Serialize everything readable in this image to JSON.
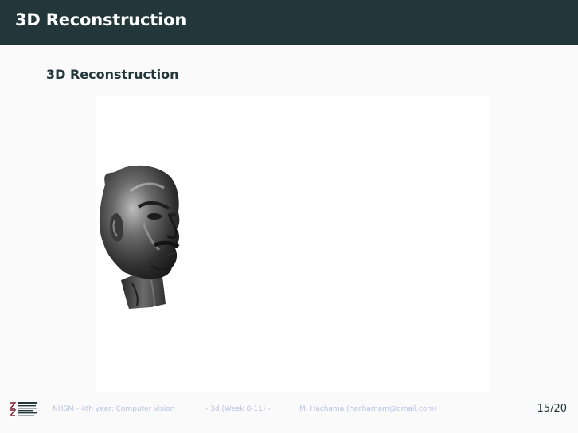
{
  "header": {
    "title": "3D Reconstruction"
  },
  "content": {
    "block_title": "3D Reconstruction",
    "figure_subject": "bronze head sculpture"
  },
  "footer": {
    "course": "NHSM - 4th year: Computer vision",
    "section": "- 3d (Week 8-11) -",
    "author": "M. Hachama (hachamam@gmail.com)",
    "page": "15/20"
  },
  "colors": {
    "title_bar": "#23373b",
    "title_text": "#ffffff",
    "background": "#fafafa",
    "footer_text": "#b7c3e6"
  }
}
